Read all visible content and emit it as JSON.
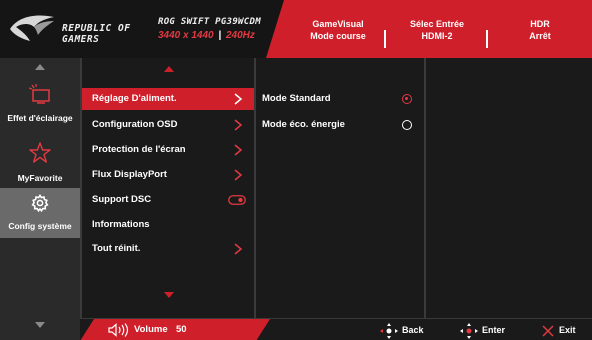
{
  "brand": {
    "line1": "REPUBLIC OF",
    "line2": "GAMERS",
    "logo_icon": "rog-eye-logo"
  },
  "model": {
    "name": "ROG SWIFT PG39WCDM",
    "resolution": "3440 x 1440",
    "separator": "|",
    "refresh": "240Hz"
  },
  "status": [
    {
      "title": "GameVisual",
      "value": "Mode course"
    },
    {
      "title": "Sélec Entrée",
      "value": "HDMI-2"
    },
    {
      "title": "HDR",
      "value": "Arrêt"
    }
  ],
  "leftnav": {
    "items": [
      {
        "label": "Effet d'éclairage",
        "icon": "monitor-light-icon",
        "active": false
      },
      {
        "label": "MyFavorite",
        "icon": "star-icon",
        "active": false
      },
      {
        "label": "Config système",
        "icon": "gear-icon",
        "active": true
      }
    ]
  },
  "menu": {
    "items": [
      {
        "label": "Réglage D'aliment.",
        "chevron": true,
        "selected": true
      },
      {
        "label": "Configuration OSD",
        "chevron": true,
        "selected": false
      },
      {
        "label": "Protection de l'écran",
        "chevron": true,
        "selected": false
      },
      {
        "label": "Flux DisplayPort",
        "chevron": true,
        "selected": false
      },
      {
        "label": "Support DSC",
        "toggle": true,
        "selected": false
      },
      {
        "label": "Informations",
        "chevron": false,
        "selected": false
      },
      {
        "label": "Tout réinit.",
        "chevron": true,
        "selected": false
      }
    ]
  },
  "submenu": {
    "items": [
      {
        "label": "Mode Standard",
        "checked": true
      },
      {
        "label": "Mode éco. énergie",
        "checked": false
      }
    ]
  },
  "footer": {
    "volume_label": "Volume",
    "volume_value": "50",
    "back_label": "Back",
    "enter_label": "Enter",
    "exit_label": "Exit"
  },
  "colors": {
    "accent": "#cf1f2a",
    "panel": "#1a1a1a",
    "nav_active": "#6a6a6a"
  }
}
